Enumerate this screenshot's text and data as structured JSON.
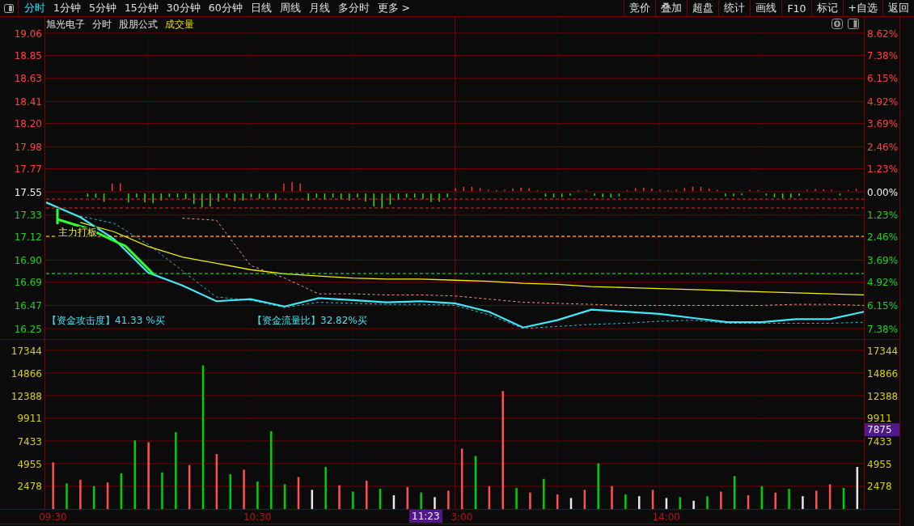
{
  "toolbar": {
    "tabs": [
      {
        "label": "分时",
        "selected": true
      },
      {
        "label": "1分钟",
        "selected": false
      },
      {
        "label": "5分钟",
        "selected": false
      },
      {
        "label": "15分钟",
        "selected": false
      },
      {
        "label": "30分钟",
        "selected": false
      },
      {
        "label": "60分钟",
        "selected": false
      },
      {
        "label": "日线",
        "selected": false
      },
      {
        "label": "周线",
        "selected": false
      },
      {
        "label": "月线",
        "selected": false
      },
      {
        "label": "多分时",
        "selected": false
      },
      {
        "label": "更多 >",
        "selected": false
      }
    ],
    "buttons": [
      "竞价",
      "叠加",
      "超盘",
      "统计",
      "画线",
      "F10",
      "标记",
      "+自选",
      "返回"
    ]
  },
  "header": {
    "stock": "旭光电子",
    "mode": "分时",
    "formula": "股朋公式",
    "indicator": "成交量"
  },
  "price_chart": {
    "chart_data": {
      "type": "line",
      "grid": true,
      "categories": [
        null,
        null,
        null,
        null,
        null,
        null,
        null,
        null,
        null,
        null,
        null,
        null,
        null,
        null,
        null,
        null,
        null,
        null,
        null,
        null,
        null,
        null,
        null,
        null,
        null
      ],
      "series": [
        {
          "color": "#40e8f8",
          "values": [
            17.45,
            17.31,
            17.1,
            16.78,
            16.66,
            16.51,
            16.53,
            16.46,
            16.54,
            16.52,
            16.5,
            16.51,
            16.49,
            16.41,
            16.26,
            16.33,
            16.43,
            16.41,
            16.39,
            16.35,
            16.31,
            16.31,
            16.34,
            16.34,
            16.41
          ]
        },
        {
          "color": "#f0f000",
          "values": [
            null,
            17.26,
            17.17,
            17.03,
            16.93,
            16.87,
            16.81,
            16.77,
            16.75,
            16.73,
            16.72,
            16.72,
            16.71,
            16.7,
            16.68,
            16.67,
            16.65,
            16.64,
            16.63,
            16.62,
            16.61,
            16.6,
            16.59,
            16.58,
            16.57
          ]
        },
        {
          "color": "#ff9090",
          "line_style": "dashed",
          "values": [
            null,
            null,
            null,
            null,
            17.3,
            17.28,
            16.85,
            16.73,
            16.58,
            16.58,
            16.57,
            16.57,
            16.56,
            16.53,
            16.5,
            16.49,
            16.48,
            16.47,
            16.47,
            16.47,
            16.47,
            16.47,
            16.48,
            16.48,
            16.47
          ]
        },
        {
          "color": "#20c0d0",
          "line_style": "dashed",
          "values": [
            null,
            17.32,
            17.25,
            17.05,
            16.8,
            16.55,
            16.52,
            16.45,
            16.5,
            16.49,
            16.48,
            16.48,
            16.47,
            16.38,
            16.25,
            16.27,
            16.29,
            16.3,
            16.32,
            16.33,
            16.3,
            16.3,
            16.3,
            16.3,
            16.31
          ]
        }
      ],
      "ylim": [
        16.25,
        19.06
      ],
      "yticks": [
        {
          "value": 19.06,
          "label": "19.06"
        },
        {
          "value": 18.85,
          "label": "18.85"
        },
        {
          "value": 18.63,
          "label": "18.63"
        },
        {
          "value": 18.41,
          "label": "18.41"
        },
        {
          "value": 18.2,
          "label": "18.20"
        },
        {
          "value": 17.98,
          "label": "17.98"
        },
        {
          "value": 17.77,
          "label": "17.77"
        },
        {
          "value": 17.55,
          "label": "17.55"
        },
        {
          "value": 17.33,
          "label": "17.33"
        },
        {
          "value": 17.12,
          "label": "17.12"
        },
        {
          "value": 16.9,
          "label": "16.90"
        },
        {
          "value": 16.69,
          "label": "16.69"
        },
        {
          "value": 16.47,
          "label": "16.47"
        },
        {
          "value": 16.25,
          "label": "16.25"
        }
      ]
    },
    "percent_axis": [
      {
        "label": "8.62%",
        "kind": "up"
      },
      {
        "label": "7.38%",
        "kind": "up"
      },
      {
        "label": "6.15%",
        "kind": "up"
      },
      {
        "label": "4.92%",
        "kind": "up"
      },
      {
        "label": "3.69%",
        "kind": "up"
      },
      {
        "label": "2.46%",
        "kind": "up"
      },
      {
        "label": "1.23%",
        "kind": "up"
      },
      {
        "label": "0.00%",
        "kind": "flat"
      },
      {
        "label": "1.23%",
        "kind": "down"
      },
      {
        "label": "2.46%",
        "kind": "down"
      },
      {
        "label": "3.69%",
        "kind": "down"
      },
      {
        "label": "4.92%",
        "kind": "down"
      },
      {
        "label": "6.15%",
        "kind": "down"
      },
      {
        "label": "7.38%",
        "kind": "down"
      }
    ],
    "signal_label": "主力打板",
    "indicators": [
      "【资金攻击度】41.33 %买",
      "【资金流量比】32.82%买"
    ]
  },
  "volume_chart": {
    "chart_data": {
      "type": "bar",
      "grid": true,
      "categories": [
        "09:30",
        null,
        null,
        null,
        null,
        null,
        null,
        null,
        null,
        null,
        null,
        null,
        null,
        null,
        null,
        "10:30",
        null,
        null,
        null,
        null,
        null,
        null,
        null,
        null,
        null,
        null,
        null,
        null,
        null,
        null,
        "3:00",
        null,
        null,
        null,
        null,
        null,
        null,
        null,
        null,
        null,
        null,
        null,
        null,
        null,
        null,
        "14:00",
        null,
        null,
        null,
        null,
        null,
        null,
        null,
        null,
        null,
        null,
        null,
        null,
        null,
        null
      ],
      "series": [
        {
          "color": "#ff5050",
          "values": [
            5100,
            null,
            3200,
            null,
            2900,
            null,
            null,
            7300,
            null,
            null,
            4800,
            null,
            6000,
            null,
            4300,
            null,
            null,
            null,
            3500,
            null,
            null,
            2600,
            null,
            3100,
            null,
            null,
            2400,
            null,
            null,
            2000,
            6600,
            null,
            2500,
            12900,
            null,
            1800,
            null,
            1600,
            null,
            2100,
            null,
            2500,
            null,
            null,
            2100,
            null,
            null,
            null,
            null,
            1900,
            null,
            1500,
            null,
            1800,
            null,
            null,
            2000,
            2700,
            null,
            null
          ]
        },
        {
          "color": "#00d000",
          "values": [
            null,
            2800,
            null,
            2500,
            null,
            3900,
            7500,
            null,
            4000,
            8400,
            null,
            15700,
            null,
            3800,
            null,
            3000,
            8500,
            2700,
            null,
            null,
            4600,
            null,
            1900,
            null,
            2200,
            null,
            null,
            1800,
            null,
            null,
            null,
            5800,
            null,
            null,
            2300,
            null,
            3300,
            null,
            null,
            null,
            5000,
            null,
            1600,
            null,
            null,
            null,
            1300,
            null,
            1400,
            null,
            3600,
            null,
            2500,
            null,
            2200,
            null,
            null,
            null,
            2300,
            null
          ]
        },
        {
          "color": "#e8e8e8",
          "values": [
            null,
            null,
            null,
            null,
            null,
            null,
            null,
            null,
            null,
            null,
            null,
            null,
            null,
            null,
            null,
            null,
            null,
            null,
            null,
            2100,
            null,
            null,
            null,
            null,
            null,
            1500,
            null,
            null,
            1300,
            null,
            null,
            null,
            null,
            null,
            null,
            null,
            null,
            null,
            1200,
            null,
            null,
            null,
            null,
            1400,
            null,
            1200,
            null,
            900,
            null,
            null,
            null,
            null,
            null,
            null,
            null,
            1400,
            null,
            null,
            null,
            4600
          ]
        }
      ],
      "ylim": [
        0,
        17344
      ],
      "yticks": [
        {
          "value": 17344,
          "label": "17344"
        },
        {
          "value": 14866,
          "label": "14866"
        },
        {
          "value": 12388,
          "label": "12388"
        },
        {
          "value": 9911,
          "label": "9911"
        },
        {
          "value": 7433,
          "label": "7433"
        },
        {
          "value": 4955,
          "label": "4955"
        },
        {
          "value": 2478,
          "label": "2478"
        }
      ]
    },
    "right_axis": [
      "17344",
      "14866",
      "12388",
      "9911",
      "7433",
      "4955",
      "2478"
    ],
    "cursor_value": "7875"
  },
  "cursor_time": "11:23"
}
